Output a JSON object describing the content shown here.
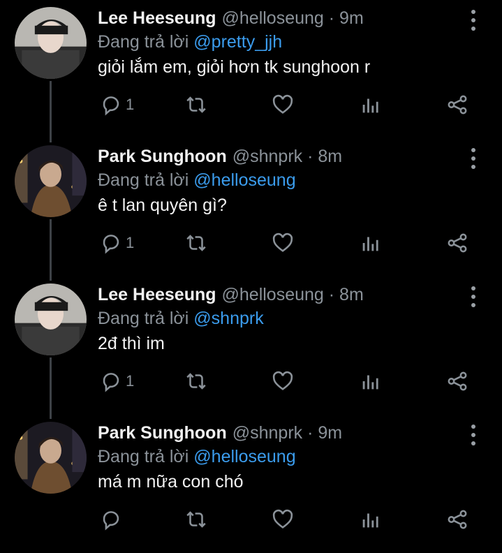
{
  "tweets": [
    {
      "name": "Lee Heeseung",
      "handle": "@helloseung · 9m",
      "reply_label": "Đang trả lời",
      "reply_to": "@pretty_jjh",
      "text": "giỏi lắm em, giỏi hơn tk sunghoon r",
      "reply_count": "1",
      "avatar": "heeseung"
    },
    {
      "name": "Park Sunghoon",
      "handle": "@shnprk · 8m",
      "reply_label": "Đang trả lời",
      "reply_to": "@helloseung",
      "text": "ê t lan quyên gì?",
      "reply_count": "1",
      "avatar": "sunghoon"
    },
    {
      "name": "Lee Heeseung",
      "handle": "@helloseung · 8m",
      "reply_label": "Đang trả lời",
      "reply_to": "@shnprk",
      "text": "2đ thì im",
      "reply_count": "1",
      "avatar": "heeseung"
    },
    {
      "name": "Park Sunghoon",
      "handle": "@shnprk · 9m",
      "reply_label": "Đang trả lời",
      "reply_to": "@helloseung",
      "text": "má m nữa con chó",
      "reply_count": "",
      "avatar": "sunghoon"
    }
  ],
  "icons": {
    "reply": "reply-icon",
    "retweet": "retweet-icon",
    "like": "heart-icon",
    "analytics": "analytics-icon",
    "share": "share-icon",
    "more": "more-vertical-icon"
  },
  "colors": {
    "background": "#000000",
    "mention": "#3b9ced",
    "muted": "#8b9299",
    "text": "#f2f2f2"
  }
}
